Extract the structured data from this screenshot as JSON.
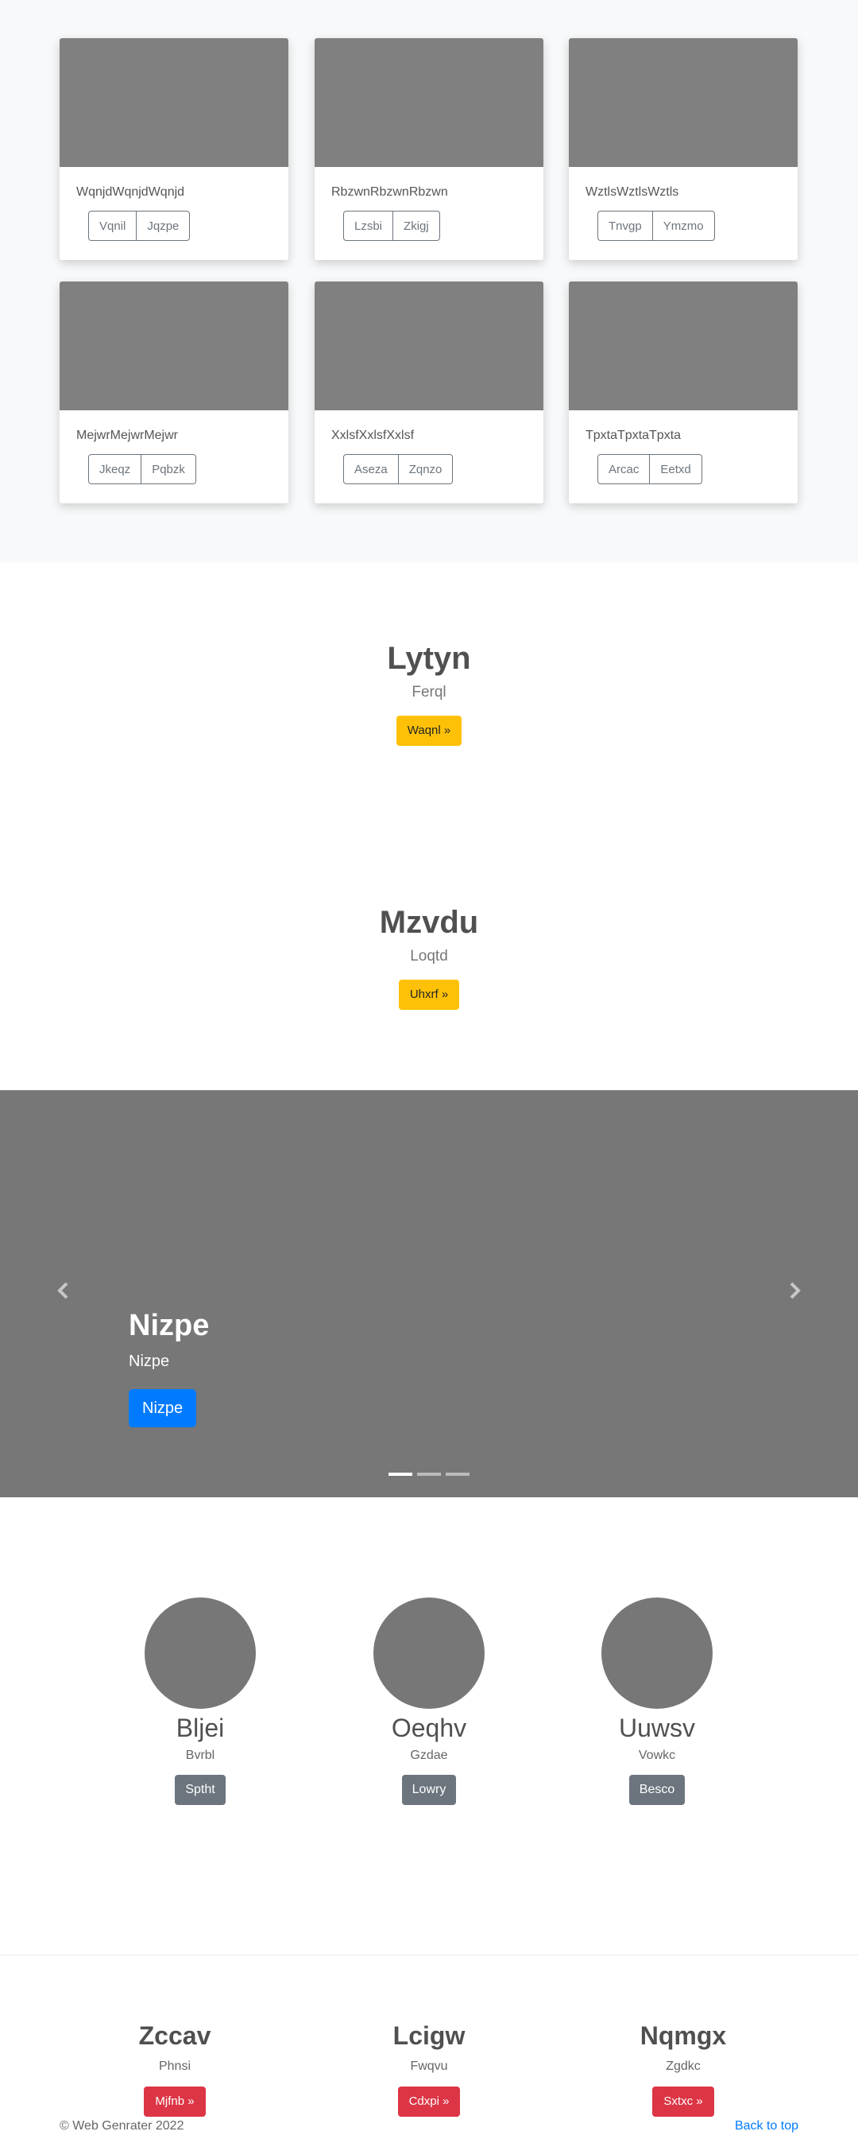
{
  "album": {
    "cards": [
      {
        "text": "WqnjdWqnjdWqnjd",
        "buttons": [
          "Vqnil",
          "Jqzpe"
        ]
      },
      {
        "text": "RbzwnRbzwnRbzwn",
        "buttons": [
          "Lzsbi",
          "Zkigj"
        ]
      },
      {
        "text": "WztlsWztlsWztls",
        "buttons": [
          "Tnvgp",
          "Ymzmo"
        ]
      },
      {
        "text": "MejwrMejwrMejwr",
        "buttons": [
          "Jkeqz",
          "Pqbzk"
        ]
      },
      {
        "text": "XxlsfXxlsfXxlsf",
        "buttons": [
          "Aseza",
          "Zqnzo"
        ]
      },
      {
        "text": "TpxtaTpxtaTpxta",
        "buttons": [
          "Arcac",
          "Eetxd"
        ]
      }
    ]
  },
  "hero1": {
    "title": "Lytyn",
    "subtitle": "Ferql",
    "button": "Waqnl »"
  },
  "hero2": {
    "title": "Mzvdu",
    "subtitle": "Loqtd",
    "button": "Uhxrf »"
  },
  "carousel": {
    "title": "Nizpe",
    "text": "Nizpe",
    "button": "Nizpe",
    "prev_icon": "chevron-left-icon",
    "next_icon": "chevron-right-icon",
    "slide_count": 3,
    "active_slide": 1
  },
  "circles": [
    {
      "title": "Bljei",
      "text": "Bvrbl",
      "button": "Sptht"
    },
    {
      "title": "Oeqhv",
      "text": "Gzdae",
      "button": "Lowry"
    },
    {
      "title": "Uuwsv",
      "text": "Vowkc",
      "button": "Besco"
    }
  ],
  "trio": [
    {
      "title": "Zccav",
      "text": "Phnsi",
      "button": "Mjfnb »"
    },
    {
      "title": "Lcigw",
      "text": "Fwqvu",
      "button": "Cdxpi »"
    },
    {
      "title": "Nqmgx",
      "text": "Zgdkc",
      "button": "Sxtxc »"
    }
  ],
  "footer": {
    "copyright": "© Web Genrater 2022",
    "back_to_top": "Back to top"
  },
  "colors": {
    "warning": "#ffc107",
    "primary": "#007bff",
    "secondary": "#6c757d",
    "danger": "#dc3545",
    "placeholder": "#808080"
  }
}
